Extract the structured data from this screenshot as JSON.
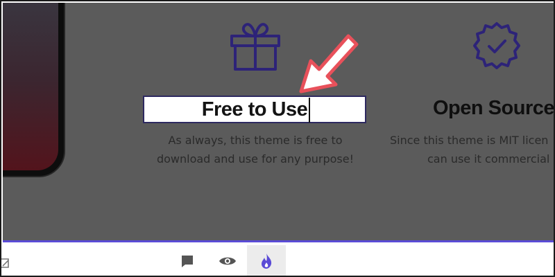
{
  "feature_1": {
    "title": "Free to Use",
    "description_line1": "As always, this theme is free to",
    "description_line2": "download and use for any purpose!"
  },
  "feature_2": {
    "title": "Open Source",
    "description_line1": "Since this theme is MIT licen",
    "description_line2": "can use it commercial"
  },
  "icons": {
    "feature_1_icon": "gift-icon",
    "feature_2_icon": "verified-badge-icon",
    "toolbar": [
      "comment-icon",
      "eye-icon",
      "flame-icon"
    ]
  },
  "colors": {
    "icon_purple": "#2d2378",
    "accent_line": "#5a4bd6",
    "arrow_red": "#e8515b",
    "overlay_gray": "#5b5b5b"
  }
}
